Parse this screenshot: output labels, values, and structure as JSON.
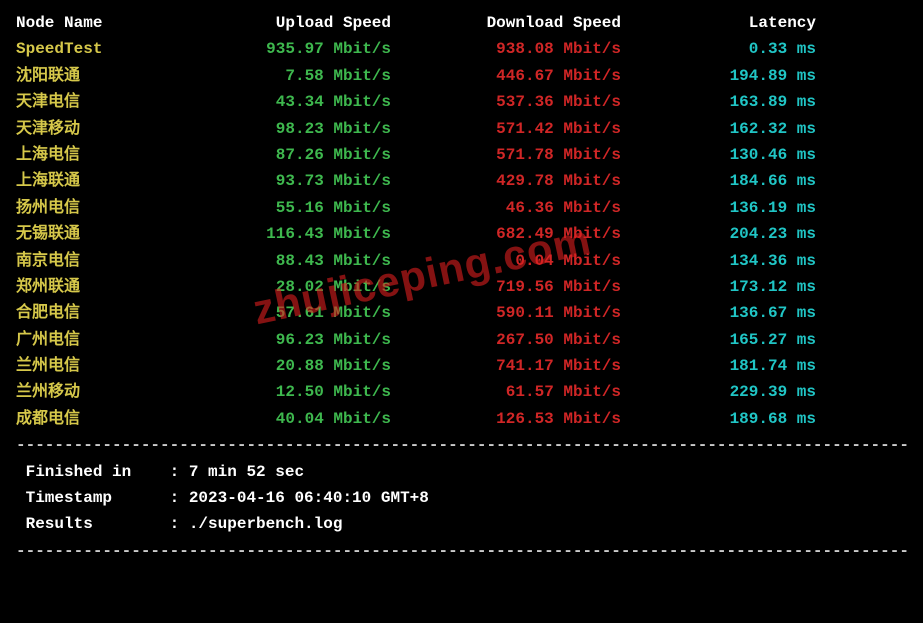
{
  "headers": {
    "node": "Node Name",
    "upload": "Upload Speed",
    "download": "Download Speed",
    "latency": "Latency"
  },
  "speedtest": {
    "name": "SpeedTest",
    "upload": "935.97 Mbit/s",
    "download": "938.08 Mbit/s",
    "latency": "0.33 ms"
  },
  "rows": [
    {
      "name": "沈阳联通",
      "upload": "7.58 Mbit/s",
      "download": "446.67 Mbit/s",
      "latency": "194.89 ms"
    },
    {
      "name": "天津电信",
      "upload": "43.34 Mbit/s",
      "download": "537.36 Mbit/s",
      "latency": "163.89 ms"
    },
    {
      "name": "天津移动",
      "upload": "98.23 Mbit/s",
      "download": "571.42 Mbit/s",
      "latency": "162.32 ms"
    },
    {
      "name": "上海电信",
      "upload": "87.26 Mbit/s",
      "download": "571.78 Mbit/s",
      "latency": "130.46 ms"
    },
    {
      "name": "上海联通",
      "upload": "93.73 Mbit/s",
      "download": "429.78 Mbit/s",
      "latency": "184.66 ms"
    },
    {
      "name": "扬州电信",
      "upload": "55.16 Mbit/s",
      "download": "46.36 Mbit/s",
      "latency": "136.19 ms"
    },
    {
      "name": "无锡联通",
      "upload": "116.43 Mbit/s",
      "download": "682.49 Mbit/s",
      "latency": "204.23 ms"
    },
    {
      "name": "南京电信",
      "upload": "88.43 Mbit/s",
      "download": "0.04 Mbit/s",
      "latency": "134.36 ms"
    },
    {
      "name": "郑州联通",
      "upload": "28.02 Mbit/s",
      "download": "719.56 Mbit/s",
      "latency": "173.12 ms"
    },
    {
      "name": "合肥电信",
      "upload": "57.61 Mbit/s",
      "download": "590.11 Mbit/s",
      "latency": "136.67 ms"
    },
    {
      "name": "广州电信",
      "upload": "96.23 Mbit/s",
      "download": "267.50 Mbit/s",
      "latency": "165.27 ms"
    },
    {
      "name": "兰州电信",
      "upload": "20.88 Mbit/s",
      "download": "741.17 Mbit/s",
      "latency": "181.74 ms"
    },
    {
      "name": "兰州移动",
      "upload": "12.50 Mbit/s",
      "download": "61.57 Mbit/s",
      "latency": "229.39 ms"
    },
    {
      "name": "成都电信",
      "upload": "40.04 Mbit/s",
      "download": "126.53 Mbit/s",
      "latency": "189.68 ms"
    }
  ],
  "footer": {
    "finished_label": " Finished in    : ",
    "finished_value": "7 min 52 sec",
    "timestamp_label": " Timestamp      : ",
    "timestamp_value": "2023-04-16 06:40:10 GMT+8",
    "results_label": " Results        : ",
    "results_value": "./superbench.log"
  },
  "divider": "----------------------------------------------------------------------------------------------",
  "watermark": "zhujiceping.com"
}
